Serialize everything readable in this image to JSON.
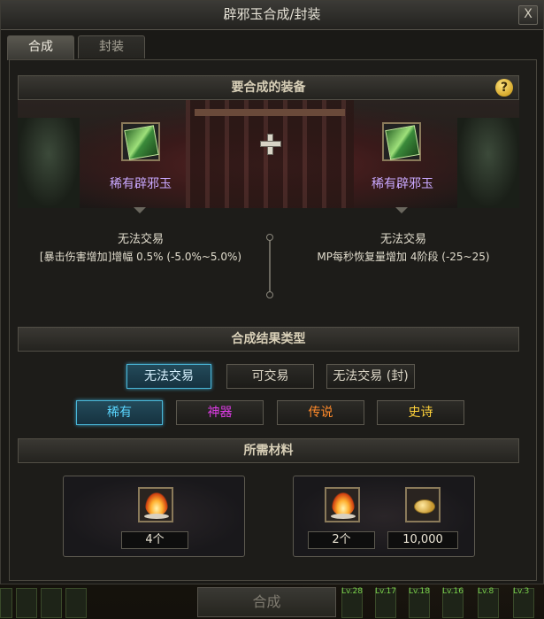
{
  "window": {
    "title": "辟邪玉合成/封装",
    "close_label": "X"
  },
  "tabs": [
    {
      "label": "合成",
      "active": true
    },
    {
      "label": "封装",
      "active": false
    }
  ],
  "equip_section": {
    "header": "要合成的装备",
    "help_label": "?",
    "left_item": {
      "name": "稀有辟邪玉",
      "trade": "无法交易",
      "stat": "[暴击伤害增加]增幅 0.5% (-5.0%~5.0%)"
    },
    "right_item": {
      "name": "稀有辟邪玉",
      "trade": "无法交易",
      "stat": "MP每秒恢复量增加 4阶段 (-25~25)"
    }
  },
  "result_section": {
    "header": "合成结果类型",
    "trade_options": [
      {
        "label": "无法交易",
        "selected": true
      },
      {
        "label": "可交易",
        "selected": false
      },
      {
        "label": "无法交易 (封)",
        "selected": false
      }
    ],
    "rarity_options": [
      {
        "label": "稀有",
        "color": "#5ad6ff",
        "selected": true
      },
      {
        "label": "神器",
        "color": "#e03ce8",
        "selected": false
      },
      {
        "label": "传说",
        "color": "#ff8a2a",
        "selected": false
      },
      {
        "label": "史诗",
        "color": "#ffd23a",
        "selected": false
      }
    ]
  },
  "materials_section": {
    "header": "所需材料",
    "box1": {
      "icon": "fire-icon",
      "count": "4个"
    },
    "box2": {
      "icon": "fire-icon",
      "count": "2个",
      "gold_icon": "coin-icon",
      "gold": "10,000"
    }
  },
  "combine_button": "合成",
  "hotbar_levels": [
    "Lv.28",
    "Lv.17",
    "Lv.18",
    "Lv.16",
    "Lv.8",
    "Lv.3"
  ]
}
